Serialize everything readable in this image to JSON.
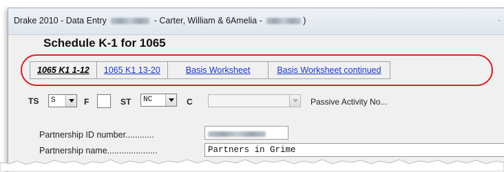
{
  "window": {
    "title_prefix": "Drake 2010 - Data Entry",
    "title_middle": "- Carter, William & 6Amelia -",
    "title_suffix": ")"
  },
  "form": {
    "title": "Schedule K-1 for 1065"
  },
  "tabs": [
    {
      "label": "1065 K1  1-12",
      "active": true
    },
    {
      "label": "1065 K1 13-20",
      "active": false
    },
    {
      "label": "Basis Worksheet",
      "active": false
    },
    {
      "label": "Basis Worksheet continued",
      "active": false
    }
  ],
  "fields": {
    "ts_label": "TS",
    "ts_value": "S",
    "f_label": "F",
    "st_label": "ST",
    "st_value": "NC",
    "c_label": "C",
    "passive_label": "Passive Activity No...",
    "partnership_id_label": "Partnership ID number............",
    "partnership_name_label": "Partnership name.....................",
    "partnership_name_value": "Partners in Grime"
  },
  "colors": {
    "link": "#1d37d0",
    "highlight": "#e02020"
  }
}
